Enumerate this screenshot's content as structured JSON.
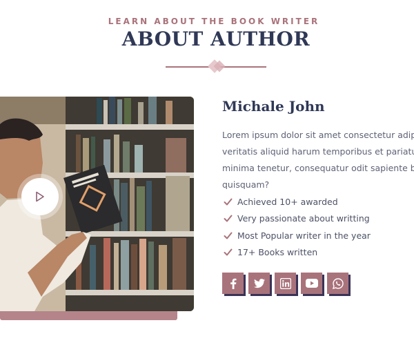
{
  "header": {
    "eyebrow": "LEARN ABOUT THE BOOK WRITER",
    "title": "ABOUT AUTHOR"
  },
  "media": {
    "play_icon": "play-icon",
    "image_subject": "man-reading-book-in-library"
  },
  "author": {
    "name": "Michale John",
    "bio_lines": [
      "Lorem ipsum dolor sit amet consectetur adipisi",
      "veritatis aliquid harum temporibus et pariatur. I",
      "minima tenetur, consequatur odit sapiente blar",
      "quisquam?"
    ],
    "achievements": [
      "Achieved 10+ awarded",
      "Very passionate about writting",
      "Most Popular writer in the year",
      "17+ Books written"
    ]
  },
  "socials": [
    "facebook-icon",
    "twitter-icon",
    "linkedin-icon",
    "youtube-icon",
    "whatsapp-icon"
  ],
  "colors": {
    "accent": "#a9737b",
    "heading": "#2f3856",
    "social_shadow": "#3a3357"
  }
}
